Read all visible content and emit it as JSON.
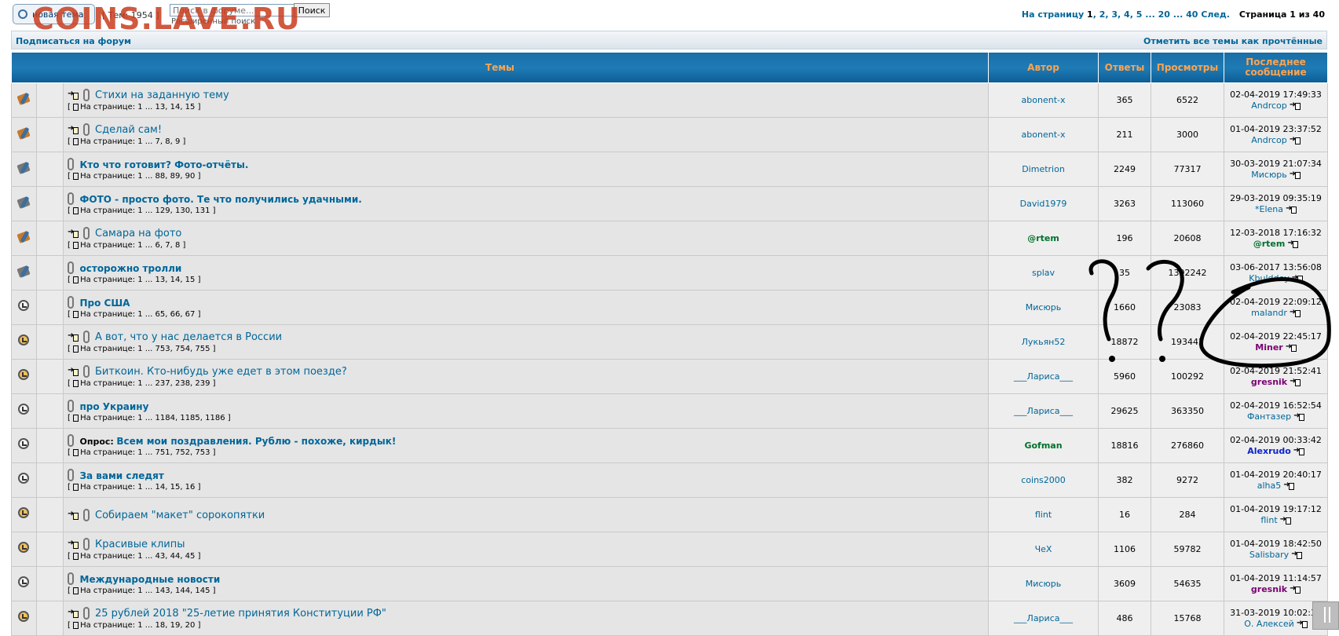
{
  "watermark": "COINS.LAVE.RU",
  "toolbar": {
    "new_topic_label": "новая тема",
    "topic_count": "[ Тем: 1954 ]",
    "search_placeholder": "Поиск в форуме...",
    "search_button": "Поиск",
    "advanced_search": "Расширенный поиск"
  },
  "pager": {
    "label": "На страницу",
    "current": "1",
    "pages": [
      "2",
      "3",
      "4",
      "5"
    ],
    "ellipsis": "...",
    "tail": [
      "20",
      "...",
      "40"
    ],
    "next": "След.",
    "page_info": "Страница 1 из 40"
  },
  "subbar": {
    "subscribe": "Подписаться на форум",
    "mark_read": "Отметить все темы как прочтённые"
  },
  "headers": {
    "topics": "Темы",
    "author": "Автор",
    "replies": "Ответы",
    "views": "Просмотры",
    "last_post": "Последнее сообщение"
  },
  "topics": [
    {
      "icon": "sticky-hot-icon",
      "new": true,
      "attach": true,
      "poll": "",
      "title": "Стихи на заданную тему",
      "pages": "На странице: 1 ... 13, 14, 15",
      "author": "abonent-x",
      "author_style": "",
      "replies": "365",
      "views": "6522",
      "last_date": "02-04-2019 17:49:33",
      "last_user": "Andrcop",
      "last_style": ""
    },
    {
      "icon": "sticky-hot-icon",
      "new": true,
      "attach": true,
      "poll": "",
      "title": "Сделай сам!",
      "pages": "На странице: 1 ... 7, 8, 9",
      "author": "abonent-x",
      "author_style": "",
      "replies": "211",
      "views": "3000",
      "last_date": "01-04-2019 23:37:52",
      "last_user": "Andrcop",
      "last_style": ""
    },
    {
      "icon": "sticky-icon",
      "new": false,
      "attach": true,
      "poll": "",
      "title": "Кто что готовит? Фото-отчёты.",
      "pages": "На странице: 1 ... 88, 89, 90",
      "author": "Dimetrion",
      "author_style": "",
      "replies": "2249",
      "views": "77317",
      "last_date": "30-03-2019 21:07:34",
      "last_user": "Мисюрь",
      "last_style": ""
    },
    {
      "icon": "sticky-icon",
      "new": false,
      "attach": true,
      "poll": "",
      "title": "ФОТО - просто фото. Те что получились удачными.",
      "pages": "На странице: 1 ... 129, 130, 131",
      "author": "David1979",
      "author_style": "",
      "replies": "3263",
      "views": "113060",
      "last_date": "29-03-2019 09:35:19",
      "last_user": "*Elena",
      "last_style": ""
    },
    {
      "icon": "sticky-hot-icon",
      "new": true,
      "attach": true,
      "poll": "",
      "title": "Самара на фото",
      "pages": "На странице: 1 ... 6, 7, 8",
      "author": "@rtem",
      "author_style": "green",
      "replies": "196",
      "views": "20608",
      "last_date": "12-03-2018 17:16:32",
      "last_user": "@rtem",
      "last_style": "green"
    },
    {
      "icon": "sticky-icon",
      "new": false,
      "attach": true,
      "poll": "",
      "title": "осторожно тролли",
      "pages": "На странице: 1 ... 13, 14, 15",
      "author": "splav",
      "author_style": "",
      "replies": "35",
      "views": "1392242",
      "last_date": "03-06-2017 13:56:08",
      "last_user": "Kbulddey",
      "last_style": ""
    },
    {
      "icon": "topic-icon",
      "new": false,
      "attach": true,
      "poll": "",
      "title": "Про США",
      "pages": "На странице: 1 ... 65, 66, 67",
      "author": "Мисюрь",
      "author_style": "",
      "replies": "1660",
      "views": "23083",
      "last_date": "02-04-2019 22:09:12",
      "last_user": "malandr",
      "last_style": ""
    },
    {
      "icon": "topic-hot-icon",
      "new": true,
      "attach": true,
      "poll": "",
      "title": "А вот, что у нас делается в России",
      "pages": "На странице: 1 ... 753, 754, 755",
      "author": "Лукьян52",
      "author_style": "",
      "replies": "18872",
      "views": "193442",
      "last_date": "02-04-2019 22:45:17",
      "last_user": "Miner",
      "last_style": "purple"
    },
    {
      "icon": "topic-hot-icon",
      "new": true,
      "attach": true,
      "poll": "",
      "title": "Биткоин. Кто-нибудь уже едет в этом поезде?",
      "pages": "На странице: 1 ... 237, 238, 239",
      "author": "___Лариса___",
      "author_style": "",
      "replies": "5960",
      "views": "100292",
      "last_date": "02-04-2019 21:52:41",
      "last_user": "gresnik",
      "last_style": "purple"
    },
    {
      "icon": "topic-icon",
      "new": false,
      "attach": true,
      "poll": "",
      "title": "про Украину",
      "pages": "На странице: 1 ... 1184, 1185, 1186",
      "author": "___Лариса___",
      "author_style": "",
      "replies": "29625",
      "views": "363350",
      "last_date": "02-04-2019 16:52:54",
      "last_user": "Фантазер",
      "last_style": ""
    },
    {
      "icon": "topic-icon",
      "new": false,
      "attach": true,
      "poll": "Опрос:",
      "title": "Всем мои поздравления. Рублю - похоже, кирдык!",
      "pages": "На странице: 1 ... 751, 752, 753",
      "author": "Gofman",
      "author_style": "green",
      "replies": "18816",
      "views": "276860",
      "last_date": "02-04-2019 00:33:42",
      "last_user": "Alexrudo",
      "last_style": "blue"
    },
    {
      "icon": "topic-icon",
      "new": false,
      "attach": true,
      "poll": "",
      "title": "За вами следят",
      "pages": "На странице: 1 ... 14, 15, 16",
      "author": "coins2000",
      "author_style": "",
      "replies": "382",
      "views": "9272",
      "last_date": "01-04-2019 20:40:17",
      "last_user": "alha5",
      "last_style": ""
    },
    {
      "icon": "topic-hot-icon",
      "new": true,
      "attach": true,
      "poll": "",
      "title": "Собираем \"макет\" сорокопятки",
      "pages": "",
      "author": "flint",
      "author_style": "",
      "replies": "16",
      "views": "284",
      "last_date": "01-04-2019 19:17:12",
      "last_user": "flint",
      "last_style": ""
    },
    {
      "icon": "topic-hot-icon",
      "new": true,
      "attach": true,
      "poll": "",
      "title": "Красивые клипы",
      "pages": "На странице: 1 ... 43, 44, 45",
      "author": "ЧеХ",
      "author_style": "",
      "replies": "1106",
      "views": "59782",
      "last_date": "01-04-2019 18:42:50",
      "last_user": "Salisbary",
      "last_style": ""
    },
    {
      "icon": "topic-icon",
      "new": false,
      "attach": true,
      "poll": "",
      "title": "Международные новости",
      "pages": "На странице: 1 ... 143, 144, 145",
      "author": "Мисюрь",
      "author_style": "",
      "replies": "3609",
      "views": "54635",
      "last_date": "01-04-2019 11:14:57",
      "last_user": "gresnik",
      "last_style": "purple"
    },
    {
      "icon": "topic-hot-icon",
      "new": true,
      "attach": true,
      "poll": "",
      "title": "25 рублей 2018 \"25-летие принятия Конституции РФ\"",
      "pages": "На странице: 1 ... 18, 19, 20",
      "author": "___Лариса___",
      "author_style": "",
      "replies": "486",
      "views": "15768",
      "last_date": "31-03-2019 10:02:32",
      "last_user": "О. Алексей",
      "last_style": ""
    }
  ],
  "annotations": {
    "marks": [
      "?",
      "?"
    ],
    "ink_color": "#000000"
  }
}
